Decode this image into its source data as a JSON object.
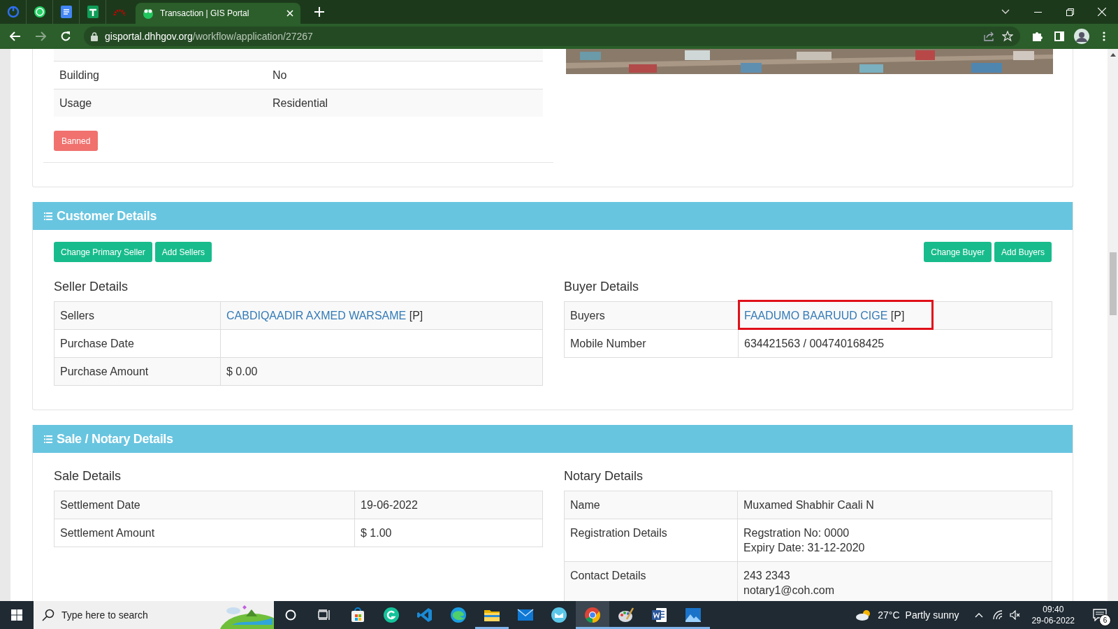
{
  "browser": {
    "tab": {
      "title": "Transaction | GIS Portal",
      "selected": true
    },
    "url": {
      "host": "gisportal.dhhgov.org",
      "path": "/workflow/application/27267"
    }
  },
  "parcel": {
    "rows": [
      {
        "label": "Building",
        "value": "No"
      },
      {
        "label": "Usage",
        "value": "Residential"
      }
    ],
    "status_badge": "Banned"
  },
  "customer_details": {
    "title": "Customer Details",
    "seller_buttons": [
      "Change Primary Seller",
      "Add Sellers"
    ],
    "buyer_buttons": [
      "Change Buyer",
      "Add Buyers"
    ],
    "seller": {
      "heading": "Seller Details",
      "rows": [
        {
          "label": "Sellers",
          "link": "CABDIQAADIR AXMED WARSAME",
          "suffix": "[P]",
          "highlighted": false
        },
        {
          "label": "Purchase Date",
          "highlighted": false
        },
        {
          "label": "Purchase Amount",
          "value": "$ 0.00",
          "highlighted": false
        }
      ]
    },
    "buyer": {
      "heading": "Buyer Details",
      "rows": [
        {
          "label": "Buyers",
          "link": "FAADUMO BAARUUD CIGE",
          "suffix": "[P]",
          "highlighted": true
        },
        {
          "label": "Mobile Number",
          "value": "634421563 / 004740168425",
          "highlighted": false
        }
      ]
    }
  },
  "sale_notary_details": {
    "title": "Sale / Notary Details",
    "sale": {
      "heading": "Sale Details",
      "rows": [
        {
          "label": "Settlement Date",
          "value": "19-06-2022"
        },
        {
          "label": "Settlement Amount",
          "value": "$ 1.00"
        }
      ]
    },
    "notary": {
      "heading": "Notary Details",
      "rows": [
        {
          "label": "Name",
          "value": "Muxamed Shabhir Caali N"
        },
        {
          "label": "Registration Details",
          "lines": [
            "Regstration No: 0000",
            "Expiry Date: 31-12-2020"
          ]
        },
        {
          "label": "Contact Details",
          "lines": [
            "243 2343",
            "notary1@coh.com"
          ]
        }
      ]
    }
  },
  "taskbar": {
    "search": {
      "placeholder": "Type here to search"
    },
    "apps": [
      {
        "running": false,
        "selected": false
      },
      {
        "running": false,
        "selected": false
      },
      {
        "running": false,
        "selected": false
      },
      {
        "running": false,
        "selected": false
      },
      {
        "running": true,
        "selected": false
      },
      {
        "running": false,
        "selected": false
      },
      {
        "running": false,
        "selected": false
      },
      {
        "running": true,
        "selected": true
      },
      {
        "running": true,
        "selected": false
      },
      {
        "running": true,
        "selected": false
      },
      {
        "running": true,
        "selected": false
      }
    ],
    "weather": {
      "temperature": "27°C",
      "condition": "Partly sunny"
    },
    "time": "09:40",
    "date": "29-06-2022",
    "notification_count": "6"
  }
}
